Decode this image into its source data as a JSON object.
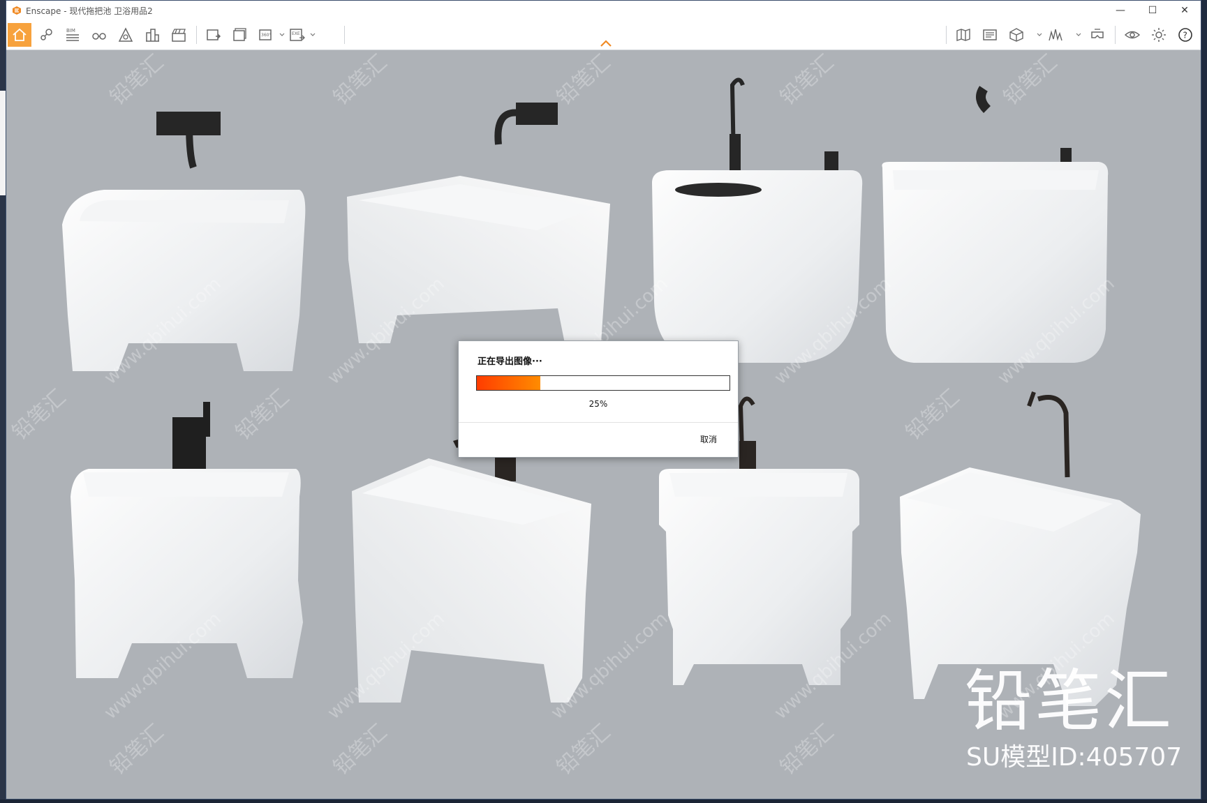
{
  "window": {
    "app_name": "Enscape",
    "title": "Enscape - 现代拖把池 卫浴用品2",
    "controls": {
      "minimize": "—",
      "maximize": "☐",
      "close": "✕"
    }
  },
  "toolbar": {
    "accent": "#f7a23d",
    "items": [
      {
        "name": "home-icon",
        "label": ""
      },
      {
        "name": "location-icon",
        "label": ""
      },
      {
        "name": "bim-icon",
        "label": "BIM"
      },
      {
        "name": "binoculars-icon",
        "label": ""
      },
      {
        "name": "asset-library-icon",
        "label": ""
      },
      {
        "name": "buildings-icon",
        "label": ""
      },
      {
        "name": "clapper-icon",
        "label": ""
      },
      {
        "name": "screenshot-icon",
        "label": ""
      },
      {
        "name": "batch-render-icon",
        "label": ""
      },
      {
        "name": "panorama-360-icon",
        "label": "360°"
      },
      {
        "name": "export-exe-icon",
        "label": "EXE"
      },
      {
        "name": "map-icon",
        "label": ""
      },
      {
        "name": "render-settings-icon",
        "label": ""
      },
      {
        "name": "cube-icon",
        "label": ""
      },
      {
        "name": "chart-icon",
        "label": ""
      },
      {
        "name": "vr-headset-icon",
        "label": ""
      },
      {
        "name": "eye-icon",
        "label": ""
      },
      {
        "name": "gear-icon",
        "label": ""
      },
      {
        "name": "help-icon",
        "label": "?"
      }
    ]
  },
  "dialog": {
    "title": "正在导出图像···",
    "progress": 0.25,
    "progress_text": "25%",
    "cancel_label": "取消",
    "progress_color_start": "#ff3c00",
    "progress_color_end": "#ff8c00"
  },
  "watermark": {
    "text_cn": "铅笔汇",
    "url": "www.qbihui.com",
    "brand_logo": "铅笔汇",
    "model_id": "SU模型ID:405707"
  },
  "viewport": {
    "background": "#aeb2b7",
    "sinks": 8
  }
}
